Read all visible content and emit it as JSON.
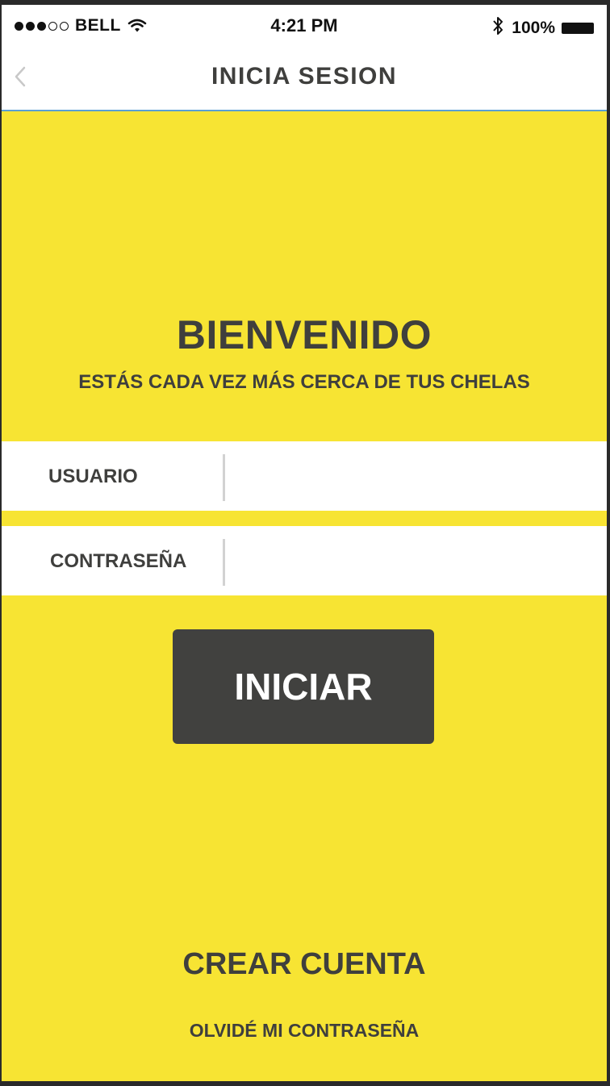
{
  "status_bar": {
    "signal_dots_filled": 3,
    "signal_dots_total": 5,
    "carrier": "BELL",
    "time": "4:21 PM",
    "battery": "100%",
    "icons": [
      "wifi-icon",
      "bluetooth-icon",
      "battery-icon"
    ]
  },
  "nav": {
    "title": "INICIA SESION",
    "back_icon": "chevron-left-icon"
  },
  "welcome": {
    "title": "BIENVENIDO",
    "subtitle": "ESTÁS CADA VEZ MÁS CERCA DE TUS CHELAS"
  },
  "form": {
    "username_label": "USUARIO",
    "username_value": "",
    "password_label": "CONTRASEÑA",
    "password_value": "",
    "submit_label": "INICIAR"
  },
  "links": {
    "create_account": "CREAR CUENTA",
    "forgot_password": "OLVIDÉ MI CONTRASEÑA"
  },
  "colors": {
    "background": "#f7e433",
    "text": "#3f3f3d",
    "button": "#41413f",
    "field_background": "#ffffff"
  }
}
